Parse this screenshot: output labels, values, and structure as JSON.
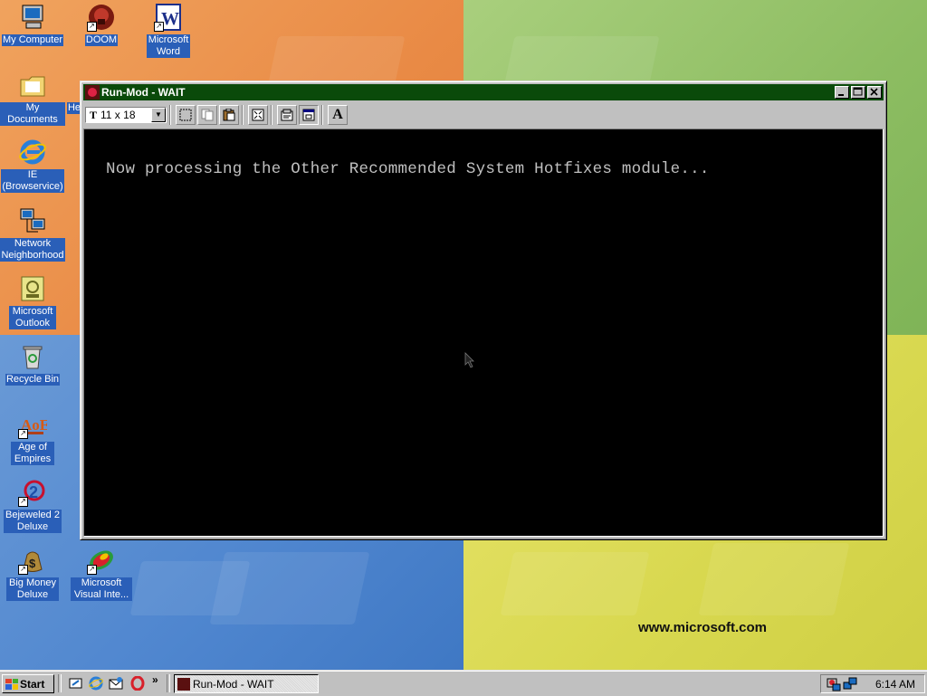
{
  "desktop": {
    "icons": [
      {
        "label": "My Computer",
        "icon": "my-computer-icon"
      },
      {
        "label": "DOOM",
        "icon": "doom-icon"
      },
      {
        "label": "Microsoft Word",
        "icon": "word-icon"
      },
      {
        "label": "My Documents",
        "icon": "folder-icon"
      },
      {
        "label": "He",
        "icon": "help-icon"
      },
      {
        "label": "IE (Browservice)",
        "icon": "ie-icon"
      },
      {
        "label": "Network Neighborhood",
        "icon": "network-icon"
      },
      {
        "label": "Microsoft Outlook",
        "icon": "outlook-icon"
      },
      {
        "label": "Recycle Bin",
        "icon": "recycle-bin-icon"
      },
      {
        "label": "Age of Empires",
        "icon": "age-of-empires-icon"
      },
      {
        "label": "Bejeweled 2 Deluxe",
        "icon": "bejeweled-icon"
      },
      {
        "label": "Big Money Deluxe",
        "icon": "big-money-icon"
      },
      {
        "label": "Microsoft Visual Inte...",
        "icon": "visual-interdev-icon"
      }
    ],
    "watermark": "www.microsoft.com"
  },
  "window": {
    "title": "Run-Mod - WAIT",
    "font_size_value": "11 x 18",
    "console_output": "Now processing the Other Recommended System Hotfixes module..."
  },
  "taskbar": {
    "start_label": "Start",
    "task_label": "Run-Mod - WAIT",
    "clock": "6:14 AM"
  },
  "colors": {
    "titlebar": "#0a4a0a",
    "console_bg": "#000000",
    "console_text": "#c0c0c0"
  }
}
